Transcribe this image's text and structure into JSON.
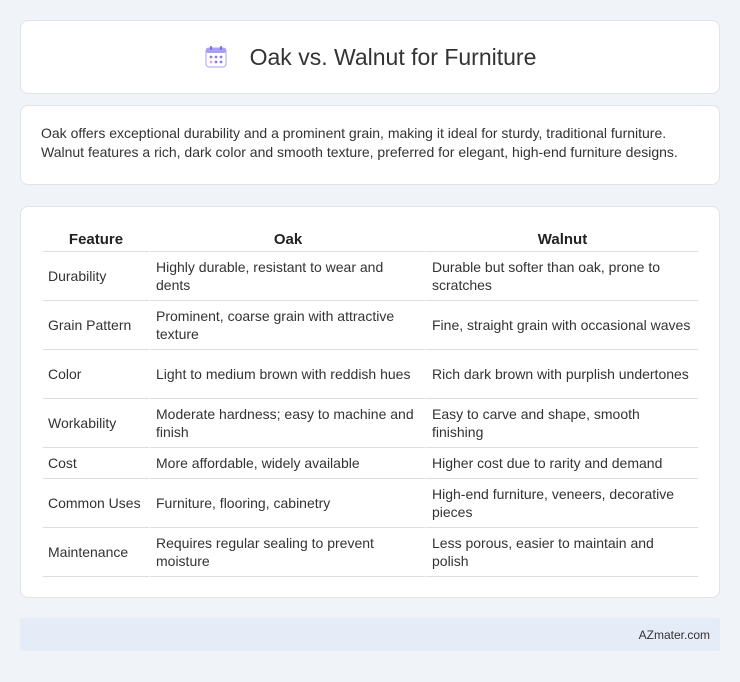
{
  "header": {
    "title": "Oak vs. Walnut for Furniture",
    "icon": "calendar-icon",
    "icon_color": "#8a7fe0"
  },
  "intro": {
    "text": "Oak offers exceptional durability and a prominent grain, making it ideal for sturdy, traditional furniture. Walnut features a rich, dark color and smooth texture, preferred for elegant, high-end furniture designs."
  },
  "table": {
    "headers": [
      "Feature",
      "Oak",
      "Walnut"
    ],
    "rows": [
      [
        "Durability",
        "Highly durable, resistant to wear and dents",
        "Durable but softer than oak, prone to scratches"
      ],
      [
        "Grain Pattern",
        "Prominent, coarse grain with attractive texture",
        "Fine, straight grain with occasional waves"
      ],
      [
        "Color",
        "Light to medium brown with reddish hues",
        "Rich dark brown with purplish undertones"
      ],
      [
        "Workability",
        "Moderate hardness; easy to machine and finish",
        "Easy to carve and shape, smooth finishing"
      ],
      [
        "Cost",
        "More affordable, widely available",
        "Higher cost due to rarity and demand"
      ],
      [
        "Common Uses",
        "Furniture, flooring, cabinetry",
        "High-end furniture, veneers, decorative pieces"
      ],
      [
        "Maintenance",
        "Requires regular sealing to prevent moisture",
        "Less porous, easier to maintain and polish"
      ]
    ]
  },
  "footer": {
    "site": "AZmater.com"
  }
}
